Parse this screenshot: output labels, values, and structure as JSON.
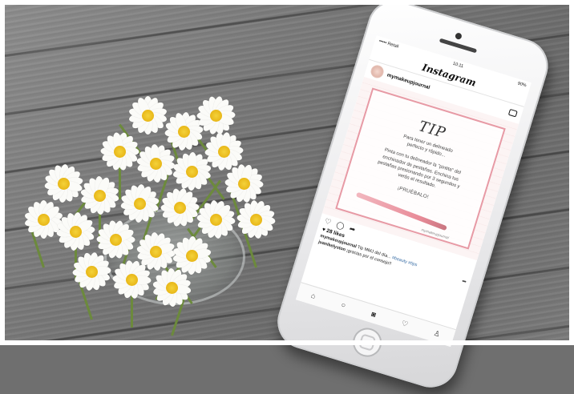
{
  "status_bar": {
    "carrier": "••••• Retail",
    "time": "10:11",
    "battery": "90%"
  },
  "app": {
    "title": "Instagram"
  },
  "post": {
    "username": "mymakeupjournal",
    "image": {
      "heading": "TIP",
      "subtitle_line1": "Para tener un delineado",
      "subtitle_line2": "perfecto y rápido...",
      "body": "Pinta con tu delineador la \"pintita\" del enchinador de pestañas. Enchina tus pestañas presionando por 3 segundos y verás el resultado.",
      "cta": "¡PRUÉBALO!",
      "watermark": "mymakeupjournal"
    },
    "likes": "28 likes",
    "caption_user": "mymakeupjournal",
    "caption_text": "Tip MMJ del día...",
    "caption_tags": "#beauty #tips",
    "comment_user": "juanikelyston",
    "comment_text": "¡gracias por el consejo!!"
  },
  "icons": {
    "like": "heart-outline-icon",
    "comment": "comment-icon",
    "share": "share-arrow-icon",
    "home": "home-icon",
    "search": "search-icon",
    "camera": "camera-icon",
    "activity": "heart-icon",
    "profile": "profile-icon"
  }
}
